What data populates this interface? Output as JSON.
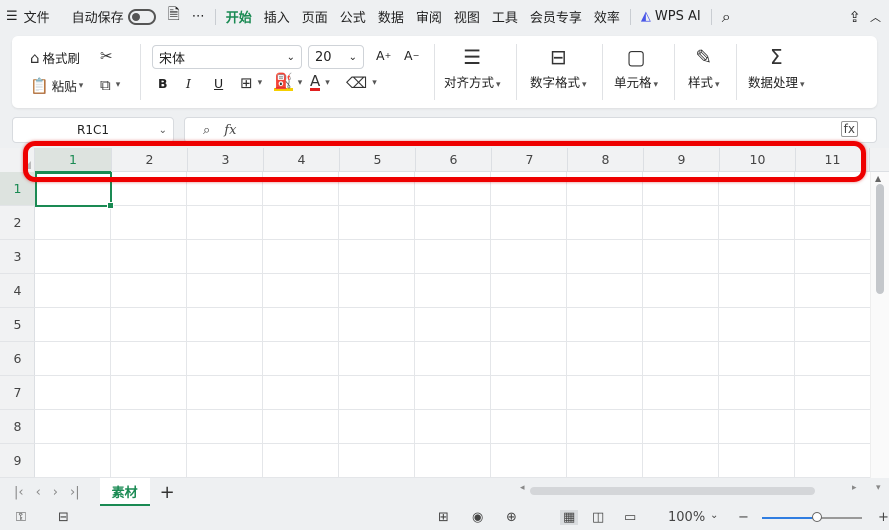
{
  "menubar": {
    "file": "文件",
    "autosave": "自动保存",
    "more": "⋯",
    "tabs": [
      "开始",
      "插入",
      "页面",
      "公式",
      "数据",
      "审阅",
      "视图",
      "工具",
      "会员专享",
      "效率"
    ],
    "active_tab": "开始",
    "wps_ai": "WPS AI"
  },
  "ribbon": {
    "format_painter": "格式刷",
    "paste": "粘贴",
    "font_name": "宋体",
    "font_size": "20",
    "bold": "B",
    "italic": "I",
    "underline": "U",
    "align": "对齐方式",
    "number_format": "数字格式",
    "cell": "单元格",
    "style": "样式",
    "data_processing": "数据处理",
    "font_color_accent": "#e02020",
    "fill_color_accent": "#f5d000"
  },
  "formula_bar": {
    "name_box": "R1C1",
    "fx_label": "fx"
  },
  "grid": {
    "columns": [
      "1",
      "2",
      "3",
      "4",
      "5",
      "6",
      "7",
      "8",
      "9",
      "10",
      "11"
    ],
    "rows": [
      "1",
      "2",
      "3",
      "4",
      "5",
      "6",
      "7",
      "8",
      "9"
    ],
    "selected_col": "1",
    "selected_row": "1"
  },
  "sheets": {
    "active": "素材",
    "add": "+"
  },
  "status": {
    "zoom": "100%"
  },
  "colors": {
    "accent": "#1a8a53",
    "highlight": "#e00000"
  }
}
